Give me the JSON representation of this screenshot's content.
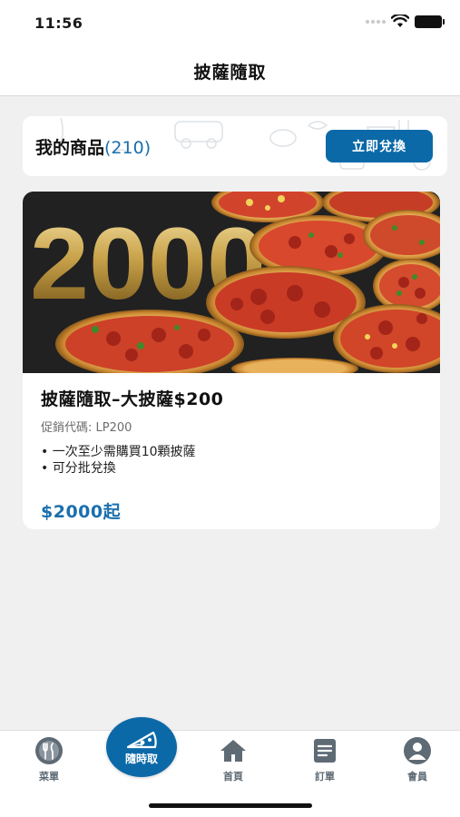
{
  "status_bar": {
    "time": "11:56"
  },
  "nav": {
    "title": "披薩隨取"
  },
  "my_products": {
    "label": "我的商品",
    "count": "(210)",
    "redeem_button": "立即兌換"
  },
  "product": {
    "banner_text": "2000",
    "name": "披薩隨取–大披薩$200",
    "promo_code": "促銷代碼: LP200",
    "bullets": [
      "一次至少需購買10顆披薩",
      "可分批兌換"
    ],
    "price": "$2000起"
  },
  "tab_bar": {
    "items": [
      {
        "label": "菜單",
        "icon": "menu-utensils-icon"
      },
      {
        "label": "隨時取",
        "icon": "pizza-slice-icon"
      },
      {
        "label": "首頁",
        "icon": "home-icon"
      },
      {
        "label": "訂單",
        "icon": "order-list-icon"
      },
      {
        "label": "會員",
        "icon": "member-icon"
      }
    ]
  },
  "colors": {
    "brand_blue": "#0b69a8",
    "accent_text": "#1a6fae"
  }
}
